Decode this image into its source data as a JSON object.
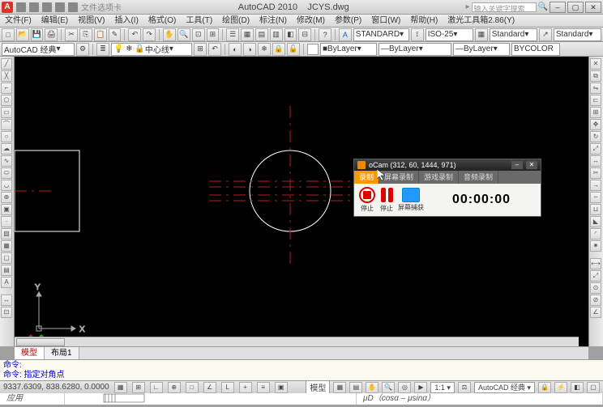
{
  "title": {
    "app": "AutoCAD 2010",
    "filename": "JCYS.dwg",
    "search_placeholder": "输入关键字搜索",
    "partial_label": "文件选项卡"
  },
  "menu": {
    "items": [
      "文件(F)",
      "编辑(E)",
      "视图(V)",
      "插入(I)",
      "格式(O)",
      "工具(T)",
      "绘图(D)",
      "标注(N)",
      "修改(M)",
      "参数(P)",
      "窗口(W)",
      "帮助(H)",
      "",
      "激光工具箱2.86(Y)"
    ]
  },
  "toolbar1": {
    "workspace_label": "AutoCAD 经典",
    "center_label": "中心线"
  },
  "toolbar2": {
    "layer_label": "ByLayer",
    "std1": "STANDARD",
    "iso": "ISO-25",
    "std2": "Standard",
    "std3": "Standard",
    "bycolor": "BYCOLOR"
  },
  "tabs": {
    "model": "模型",
    "layout1": "布局1"
  },
  "cmd": {
    "line1": "命令:",
    "line2": "命令: 指定对角点",
    "line3": "命令:"
  },
  "status": {
    "coords": "9337.6309, 838.6280, 0.0000",
    "ws": "AutoCAD 经典",
    "scale": "1:1"
  },
  "bottom": {
    "apply": "应用",
    "expr": "μD（cosα – μsinα）"
  },
  "ocam": {
    "title": "oCam (312, 60, 1444, 971)",
    "tabs": [
      "录制",
      "屏幕录制",
      "游戏录制",
      "音频录制"
    ],
    "stop_label": "停止",
    "pause_label": "停止",
    "capture_label": "屏幕捕获",
    "time": "00:00:00"
  },
  "axes": {
    "x": "X",
    "y": "Y"
  },
  "colors": {
    "canvas_bg": "#000000",
    "crosshair": "#b02020",
    "geometry": "#ffffff",
    "axis": "#888888"
  }
}
